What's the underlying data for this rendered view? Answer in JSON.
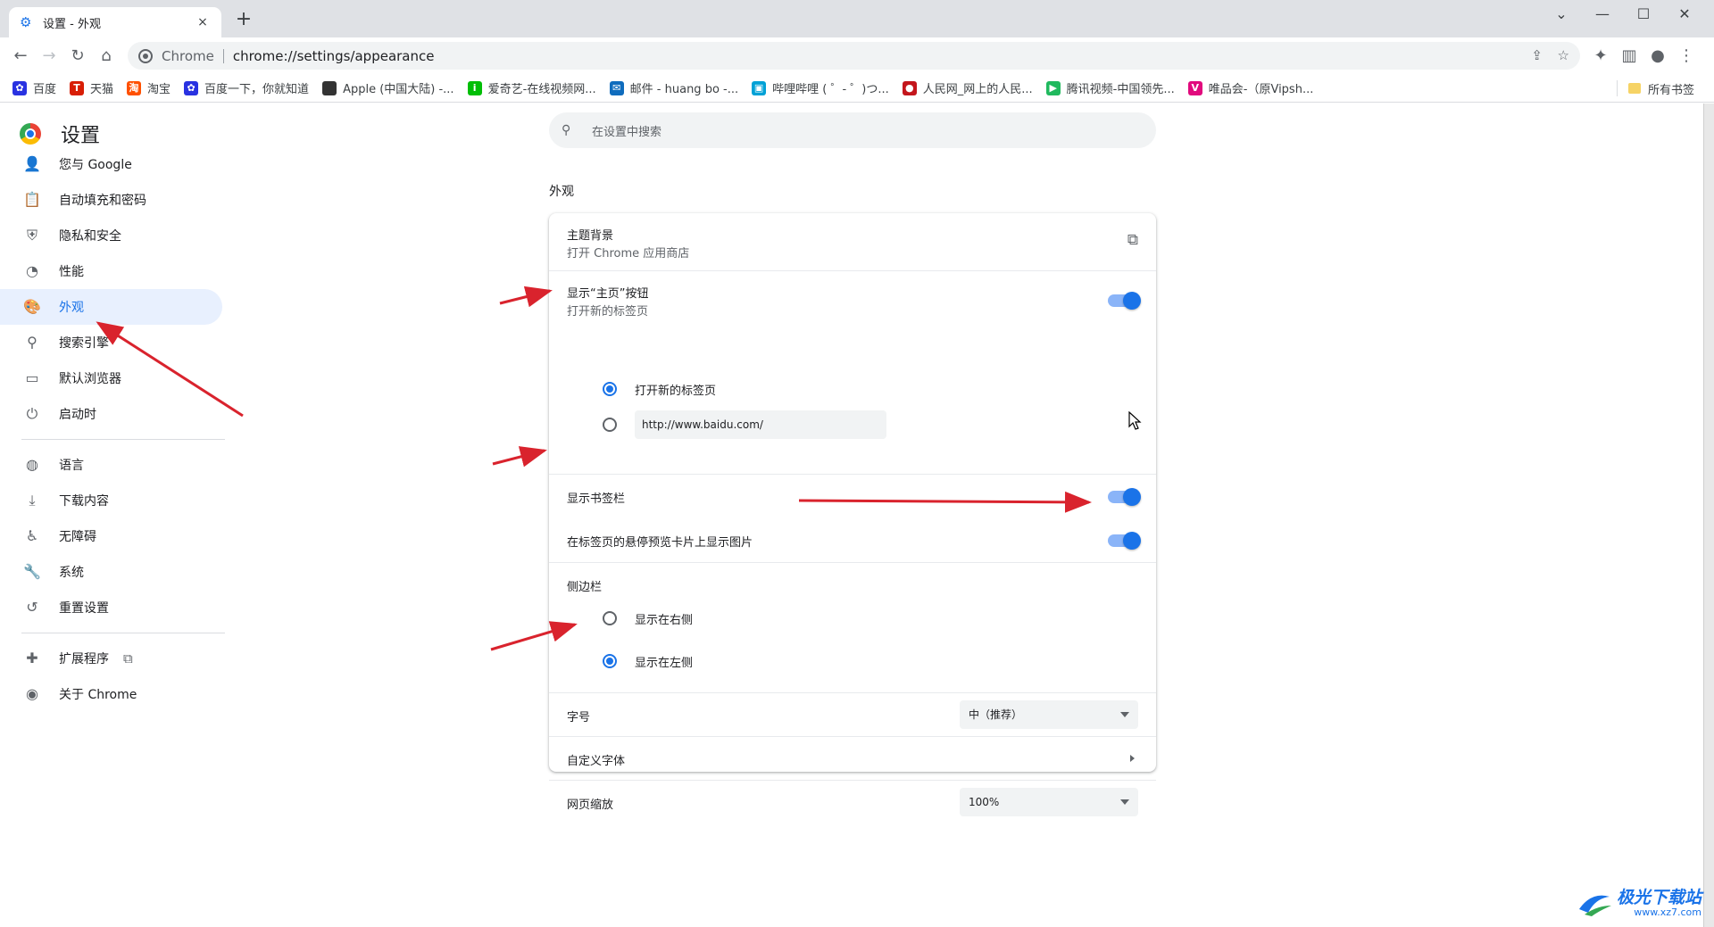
{
  "browser": {
    "tab_title": "设置 - 外观",
    "tab_close": "×",
    "new_tab": "+",
    "omnibox_chip": "Chrome",
    "omnibox_url": "chrome://settings/appearance"
  },
  "bookmarks": {
    "items": [
      {
        "label": "百度",
        "icon": "baidu-icon",
        "color": "#2932e1"
      },
      {
        "label": "天猫",
        "icon": "tmall-icon",
        "color": "#d81e06"
      },
      {
        "label": "淘宝",
        "icon": "taobao-icon",
        "color": "#ff5000"
      },
      {
        "label": "百度一下，你就知道",
        "icon": "baidu-icon",
        "color": "#2932e1"
      },
      {
        "label": "Apple (中国大陆) -...",
        "icon": "apple-icon",
        "color": "#333333"
      },
      {
        "label": "爱奇艺-在线视频网...",
        "icon": "iqiyi-icon",
        "color": "#00be06"
      },
      {
        "label": "邮件 - huang bo -...",
        "icon": "mail-icon",
        "color": "#0f6cbd"
      },
      {
        "label": "哔哩哔哩 ( ゜- ゜)つ...",
        "icon": "bilibili-icon",
        "color": "#00a1d6"
      },
      {
        "label": "人民网_网上的人民...",
        "icon": "people-icon",
        "color": "#c4161c"
      },
      {
        "label": "腾讯视频-中国领先...",
        "icon": "tencent-video-icon",
        "color": "#20b95e"
      },
      {
        "label": "唯品会-（原Vipsh...",
        "icon": "vip-icon",
        "color": "#e10a7d"
      }
    ],
    "all_bookmarks": "所有书签"
  },
  "sidebar": {
    "title": "设置",
    "items": [
      {
        "label": "您与 Google",
        "icon": "person-icon"
      },
      {
        "label": "自动填充和密码",
        "icon": "clipboard-icon"
      },
      {
        "label": "隐私和安全",
        "icon": "shield-icon"
      },
      {
        "label": "性能",
        "icon": "speedometer-icon"
      },
      {
        "label": "外观",
        "icon": "palette-icon",
        "active": true
      },
      {
        "label": "搜索引擎",
        "icon": "search-icon"
      },
      {
        "label": "默认浏览器",
        "icon": "browser-icon"
      },
      {
        "label": "启动时",
        "icon": "power-icon"
      }
    ],
    "items2": [
      {
        "label": "语言",
        "icon": "globe-icon"
      },
      {
        "label": "下载内容",
        "icon": "download-icon"
      },
      {
        "label": "无障碍",
        "icon": "accessibility-icon"
      },
      {
        "label": "系统",
        "icon": "wrench-icon"
      },
      {
        "label": "重置设置",
        "icon": "history-icon"
      }
    ],
    "items3": [
      {
        "label": "扩展程序",
        "icon": "puzzle-icon"
      },
      {
        "label": "关于 Chrome",
        "icon": "chrome-icon"
      }
    ]
  },
  "search": {
    "placeholder": "在设置中搜索"
  },
  "appearance": {
    "section_title": "外观",
    "theme": {
      "title": "主题背景",
      "subtitle": "打开 Chrome 应用商店"
    },
    "home_button": {
      "title": "显示“主页”按钮",
      "subtitle": "打开新的标签页",
      "enabled": true
    },
    "home_options": {
      "new_tab": "打开新的标签页",
      "custom_url": "http://www.baidu.com/",
      "selected": "new_tab"
    },
    "bookmarks_bar": {
      "title": "显示书签栏",
      "enabled": true
    },
    "tab_hover": {
      "title": "在标签页的悬停预览卡片上显示图片",
      "enabled": true
    },
    "side_panel": {
      "title": "侧边栏",
      "right": "显示在右侧",
      "left": "显示在左侧",
      "selected": "left"
    },
    "font_size": {
      "title": "字号",
      "value": "中（推荐）"
    },
    "custom_fonts": {
      "title": "自定义字体"
    },
    "page_zoom": {
      "title": "网页缩放",
      "value": "100%"
    }
  },
  "watermark": {
    "name": "极光下载站",
    "url": "www.xz7.com"
  },
  "colors": {
    "accent": "#1a73e8",
    "arrow": "#d9232d"
  }
}
